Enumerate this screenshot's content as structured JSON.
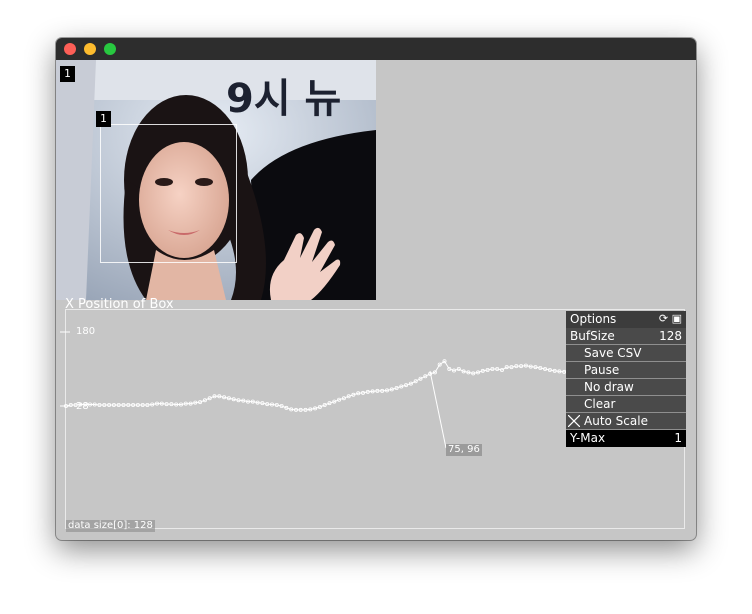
{
  "window": {
    "traffic_lights": {
      "close": "#fe5f57",
      "minimize": "#febc2e",
      "zoom": "#28c840"
    }
  },
  "video": {
    "overlay_sign_text": "9시 뉴",
    "frame_badge": "1",
    "face_badge": "1"
  },
  "plot": {
    "title": "X Position of Box",
    "y_tick_top": "180",
    "y_tick_bottom": "28",
    "tooltip": "75, 96",
    "footer": "data size[0]: 128"
  },
  "options_panel": {
    "header": "Options",
    "header_icons": [
      "refresh-icon",
      "save-disk-icon"
    ],
    "bufsize_label": "BufSize",
    "bufsize_value": "128",
    "save_csv": "Save CSV",
    "pause": "Pause",
    "no_draw": "No draw",
    "clear": "Clear",
    "auto_scale": "Auto Scale",
    "auto_scale_checked": true,
    "ymax_label": "Y-Max",
    "ymax_value": "1"
  },
  "chart_data": {
    "type": "line",
    "title": "X Position of Box",
    "y_ticks": [
      180,
      28
    ],
    "ylim": [
      28,
      180
    ],
    "series": [
      {
        "values": [
          28,
          30,
          30,
          31,
          31,
          31,
          31,
          30,
          30,
          30,
          30,
          30,
          30,
          30,
          30,
          30,
          30,
          30,
          31,
          33,
          33,
          32,
          32,
          31,
          31,
          33,
          33,
          35,
          36,
          40,
          44,
          48,
          48,
          46,
          44,
          42,
          40,
          39,
          37,
          37,
          35,
          34,
          32,
          31,
          30,
          28,
          24,
          21,
          20,
          20,
          20,
          21,
          23,
          26,
          30,
          34,
          37,
          41,
          44,
          48,
          51,
          54,
          55,
          57,
          58,
          59,
          59,
          60,
          62,
          65,
          68,
          71,
          74,
          79,
          84,
          89,
          94,
          97,
          113,
          120,
          104,
          101,
          104,
          99,
          97,
          95,
          97,
          100,
          102,
          104,
          104,
          102,
          108,
          108,
          110,
          110,
          111,
          109,
          108,
          106,
          104,
          102,
          100,
          99,
          98,
          97,
          96,
          94,
          93,
          92,
          91,
          89,
          88,
          88,
          87,
          86,
          85,
          85,
          84,
          83,
          82,
          81,
          80,
          79,
          78,
          78,
          77,
          76,
          75,
          75
        ]
      }
    ]
  }
}
